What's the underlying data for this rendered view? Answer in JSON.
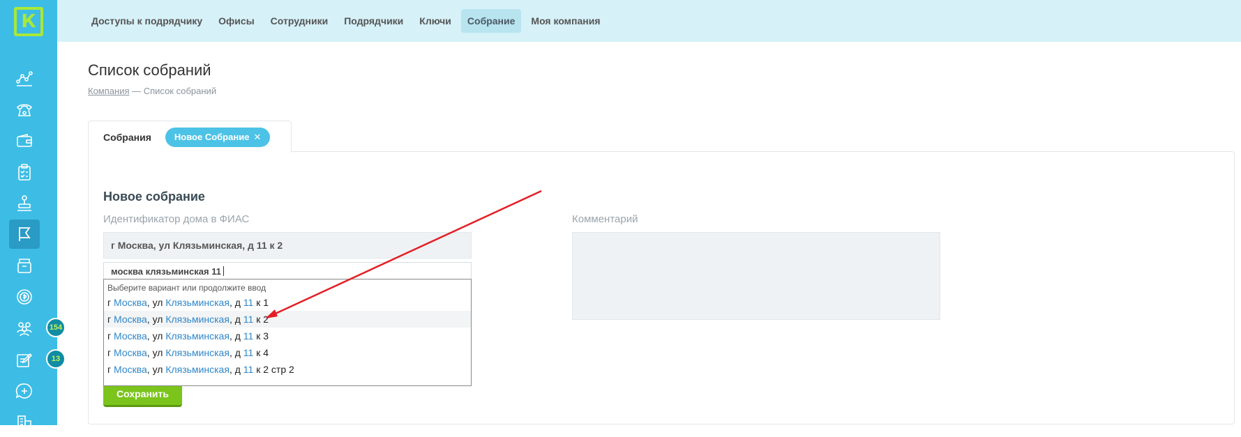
{
  "app": {
    "logo_letter": "К"
  },
  "colors": {
    "sidebar": "#3dbde5",
    "nav_bg": "#d6f1f8",
    "accent": "#4cc2e6",
    "save": "#7bc41c",
    "badge": "#108ca3",
    "annotation_arrow": "#e31e24"
  },
  "sidebar": {
    "icons": [
      {
        "name": "analytics-icon"
      },
      {
        "name": "phone-icon"
      },
      {
        "name": "wallet-icon"
      },
      {
        "name": "clipboard-check-icon"
      },
      {
        "name": "stamp-icon"
      },
      {
        "name": "flag-icon",
        "active": true
      },
      {
        "name": "archive-box-icon"
      },
      {
        "name": "coin-icon"
      },
      {
        "name": "users-icon",
        "badge": "154"
      },
      {
        "name": "edit-note-icon",
        "badge": "13"
      },
      {
        "name": "chat-add-icon"
      },
      {
        "name": "building-icon"
      }
    ]
  },
  "topnav": {
    "items": [
      {
        "label": "Доступы к подрядчику"
      },
      {
        "label": "Офисы"
      },
      {
        "label": "Сотрудники"
      },
      {
        "label": "Подрядчики"
      },
      {
        "label": "Ключи"
      },
      {
        "label": "Собрание",
        "active": true
      },
      {
        "label": "Моя компания"
      }
    ]
  },
  "page": {
    "title": "Список собраний",
    "breadcrumb": {
      "link": "Компания",
      "separator": " — ",
      "current": "Список собраний"
    }
  },
  "tabs": {
    "list_tab": "Собрания",
    "new_tab": "Новое Собрание",
    "new_tab_close": "✕"
  },
  "form": {
    "title": "Новое собрание",
    "fias_label": "Идентификатор дома в ФИАС",
    "fias_value": "г Москва, ул Клязьминская, д 11 к 2",
    "comment_label": "Комментарий",
    "comment_value": "",
    "search_value": "москва клязьминская 11",
    "save_label": "Сохранить"
  },
  "suggestions": {
    "hint": "Выберите вариант или продолжите ввод",
    "items": [
      {
        "p1": "г ",
        "city": "Москва",
        "p2": ", ул ",
        "street": "Клязьминская",
        "p3": ", д ",
        "house": "11",
        "rest": " к 1"
      },
      {
        "p1": "г ",
        "city": "Москва",
        "p2": ", ул ",
        "street": "Клязьминская",
        "p3": ", д ",
        "house": "11",
        "rest": " к 2",
        "highlighted": true
      },
      {
        "p1": "г ",
        "city": "Москва",
        "p2": ", ул ",
        "street": "Клязьминская",
        "p3": ", д ",
        "house": "11",
        "rest": " к 3"
      },
      {
        "p1": "г ",
        "city": "Москва",
        "p2": ", ул ",
        "street": "Клязьминская",
        "p3": ", д ",
        "house": "11",
        "rest": " к 4"
      },
      {
        "p1": "г ",
        "city": "Москва",
        "p2": ", ул ",
        "street": "Клязьминская",
        "p3": ", д ",
        "house": "11",
        "rest": " к 2 стр 2"
      }
    ]
  }
}
